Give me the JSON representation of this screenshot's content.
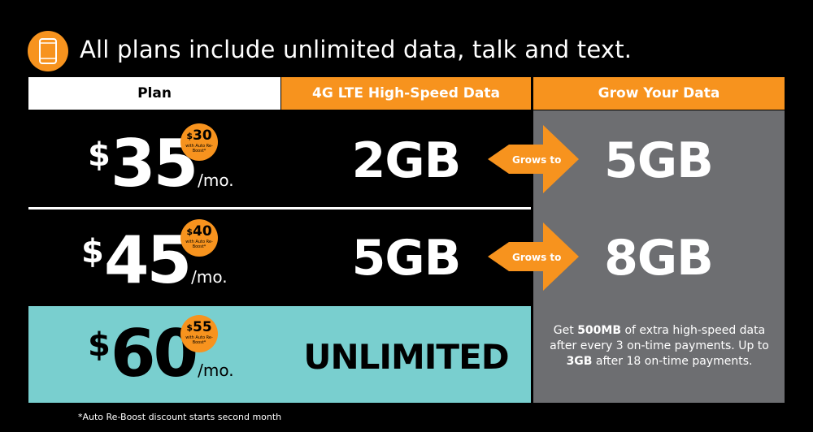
{
  "headline": "All plans include unlimited data, talk and text.",
  "headers": {
    "plan": "Plan",
    "data": "4G LTE High-Speed Data",
    "grow": "Grow Your Data"
  },
  "plans": [
    {
      "currency": "$",
      "price": "35",
      "per": "/mo.",
      "discount_currency": "$",
      "discount_price": "30",
      "discount_note": "with Auto Re-Boost*",
      "data": "2GB",
      "arrow_label": "Grows to",
      "grows_to": "5GB"
    },
    {
      "currency": "$",
      "price": "45",
      "per": "/mo.",
      "discount_currency": "$",
      "discount_price": "40",
      "discount_note": "with Auto Re-Boost*",
      "data": "5GB",
      "arrow_label": "Grows to",
      "grows_to": "8GB"
    },
    {
      "currency": "$",
      "price": "60",
      "per": "/mo.",
      "discount_currency": "$",
      "discount_price": "55",
      "discount_note": "with Auto Re-Boost*",
      "data": "UNLIMITED"
    }
  ],
  "grow_note": {
    "part1": "Get ",
    "bold1": "500MB",
    "part2": " of extra high-speed data after every 3 on-time payments. Up to ",
    "bold2": "3GB",
    "part3": " after 18 on-time payments."
  },
  "footnote": "*Auto Re-Boost discount starts second month",
  "colors": {
    "accent": "#f7931e",
    "grow_bg": "#6d6e71",
    "unlimited_bg": "#79cfcf",
    "background": "#000000"
  },
  "icons": {
    "headline": "phone-icon"
  }
}
